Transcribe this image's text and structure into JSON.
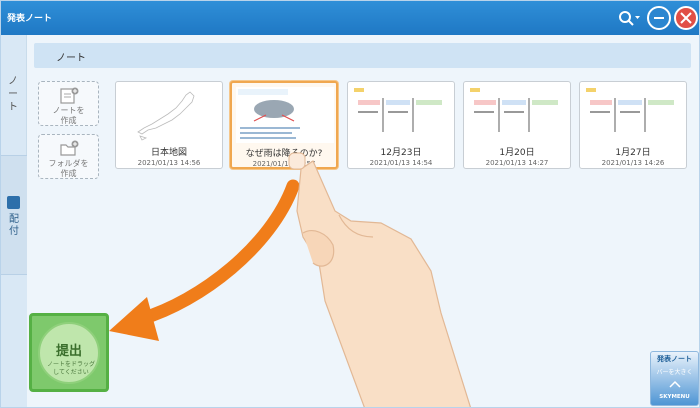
{
  "window": {
    "title": "発表ノート"
  },
  "left_rail": {
    "tab_note": "ノート",
    "tab_distribute": "配付"
  },
  "header": {
    "label": "ノート"
  },
  "actions": {
    "create_note": "ノートを\n作成",
    "create_folder": "フォルダを\n作成"
  },
  "cards": [
    {
      "title": "日本地図",
      "date": "2021/01/13 14:56"
    },
    {
      "title": "なぜ雨は降るのか?",
      "date": "2021/01/13 14:57"
    },
    {
      "title": "12月23日",
      "date": "2021/01/13 14:54"
    },
    {
      "title": "1月20日",
      "date": "2021/01/13 14:27"
    },
    {
      "title": "1月27日",
      "date": "2021/01/13 14:26"
    }
  ],
  "submit": {
    "label": "提出",
    "hint": "ノートをドラッグ\nしてください"
  },
  "skymenu": {
    "title": "発表ノート",
    "bar": "バーを大きく",
    "brand": "SKYMENU"
  },
  "colors": {
    "titlebar": "#2f8fd8",
    "accent_orange": "#f07d1a",
    "submit_green": "#7ec96c"
  }
}
